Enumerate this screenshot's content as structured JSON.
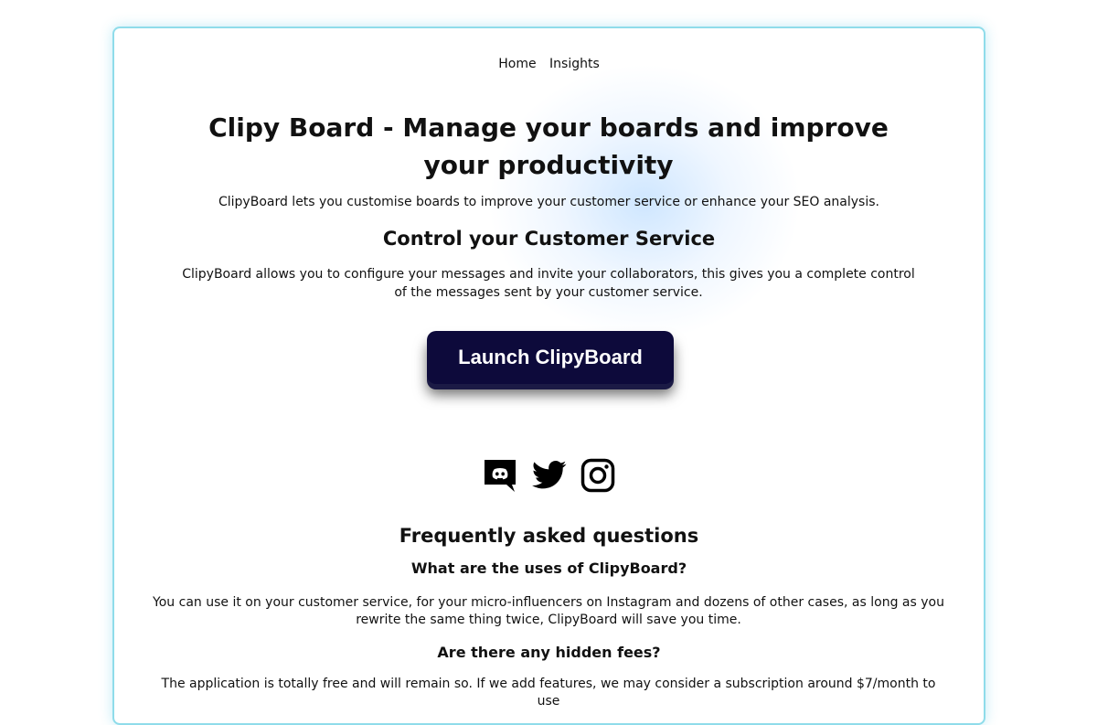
{
  "nav": {
    "items": [
      "Home",
      "Insights"
    ]
  },
  "hero": {
    "title": "Clipy Board - Manage your boards and improve your productivity",
    "subtitle": "ClipyBoard lets you customise boards to improve your customer service or enhance your SEO analysis."
  },
  "section": {
    "title": "Control your Customer Service",
    "text": "ClipyBoard allows you to configure your messages and invite your collaborators, this gives you a complete control of the messages sent by your customer service."
  },
  "cta": {
    "label": "Launch ClipyBoard"
  },
  "social": {
    "icons": [
      "discord-icon",
      "twitter-icon",
      "instagram-icon"
    ]
  },
  "faq": {
    "title": "Frequently asked questions",
    "items": [
      {
        "question": "What are the uses of ClipyBoard?",
        "answer": "You can use it on your customer service, for your micro-influencers on Instagram and dozens of other cases, as long as you rewrite the same thing twice, ClipyBoard will save you time."
      },
      {
        "question": "Are there any hidden fees?",
        "answer": "The application is totally free and will remain so. If we add features, we may consider a subscription around $7/month to use"
      }
    ]
  },
  "colors": {
    "card_border": "#8fdcea",
    "button_bg": "#0d0a3b",
    "button_text": "#ffffff"
  }
}
